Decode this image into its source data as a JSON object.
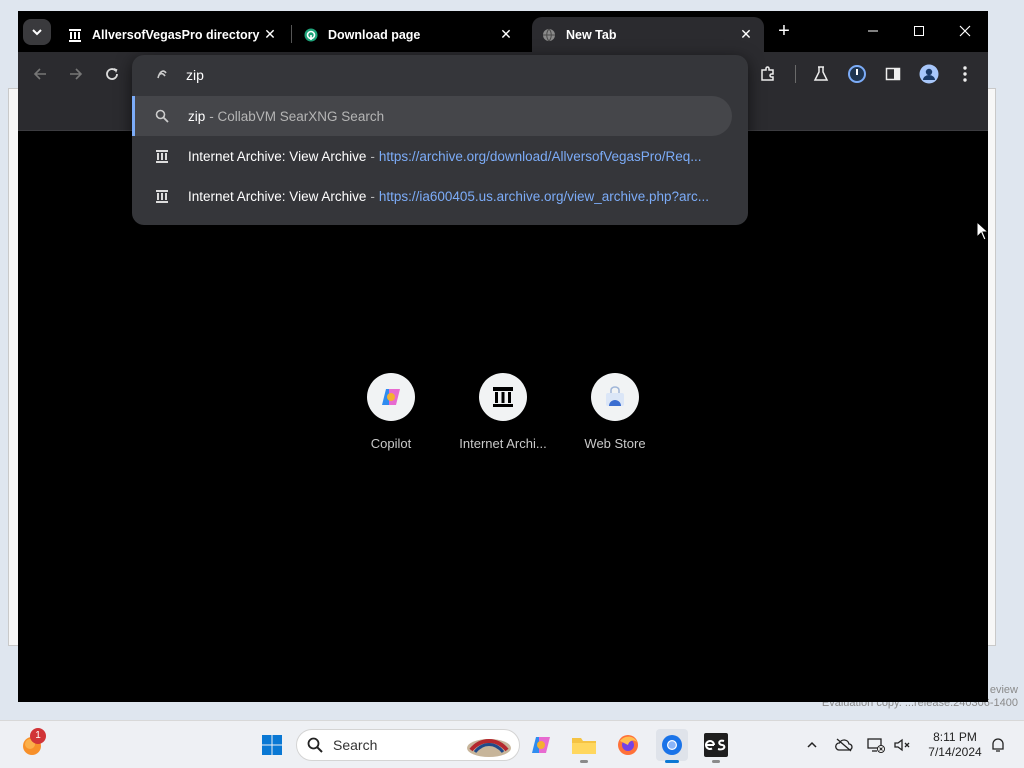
{
  "browser": {
    "tabs": [
      {
        "label": "AllversofVegasPro directory lis",
        "icon": "archive-icon",
        "active": false
      },
      {
        "label": "Download page",
        "icon": "download-page-icon",
        "active": false
      },
      {
        "label": "New Tab",
        "icon": "globe-icon",
        "active": true
      }
    ],
    "omnibox": {
      "query": "zip",
      "suggestions": [
        {
          "main": "zip",
          "sub": "- CollabVM SearXNG Search",
          "url": "",
          "icon": "search-icon",
          "selected": true
        },
        {
          "main": "Internet Archive: View Archive",
          "sub": "-",
          "url": "https://archive.org/download/AllversofVegasPro/Req...",
          "icon": "archive-icon",
          "selected": false
        },
        {
          "main": "Internet Archive: View Archive",
          "sub": "-",
          "url": "https://ia600405.us.archive.org/view_archive.php?arc...",
          "icon": "archive-icon",
          "selected": false
        }
      ]
    },
    "shortcuts": [
      {
        "label": "Copilot",
        "icon": "copilot-icon"
      },
      {
        "label": "Internet Archi...",
        "icon": "archive-icon"
      },
      {
        "label": "Web Store",
        "icon": "web-store-icon"
      }
    ]
  },
  "taskbar": {
    "search_label": "Search",
    "time": "8:11 PM",
    "date": "7/14/2024",
    "notification_count": "1"
  },
  "desktop": {
    "watermark_line1": "eview",
    "watermark_line2": "Evaluation copy. ...release.240306-1400"
  },
  "colors": {
    "accent": "#7cacf8",
    "toolbar": "#2b2b2f",
    "omnibox": "#35363a"
  }
}
